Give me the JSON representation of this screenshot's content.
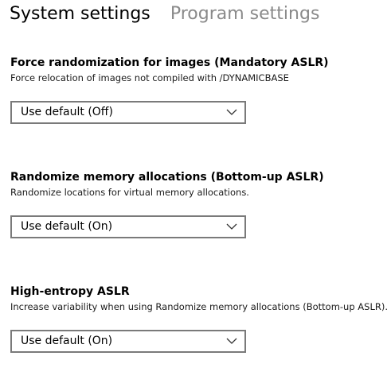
{
  "tabs": [
    {
      "label": "System settings",
      "active": true
    },
    {
      "label": "Program settings",
      "active": false
    }
  ],
  "sections": [
    {
      "title": "Force randomization for images (Mandatory ASLR)",
      "description": "Force relocation of images not compiled with /DYNAMICBASE",
      "select_value": "Use default (Off)"
    },
    {
      "title": "Randomize memory allocations (Bottom-up ASLR)",
      "description": "Randomize locations for virtual memory allocations.",
      "select_value": "Use default (On)"
    },
    {
      "title": "High-entropy ASLR",
      "description": "Increase variability when using Randomize memory allocations (Bottom-up ASLR).",
      "select_value": "Use default (On)"
    }
  ],
  "icons": {
    "dropdown": "chevron-down-icon"
  },
  "colors": {
    "active_tab": "#000000",
    "inactive_tab": "#8a8a8a",
    "select_border": "#7a7a7a"
  }
}
